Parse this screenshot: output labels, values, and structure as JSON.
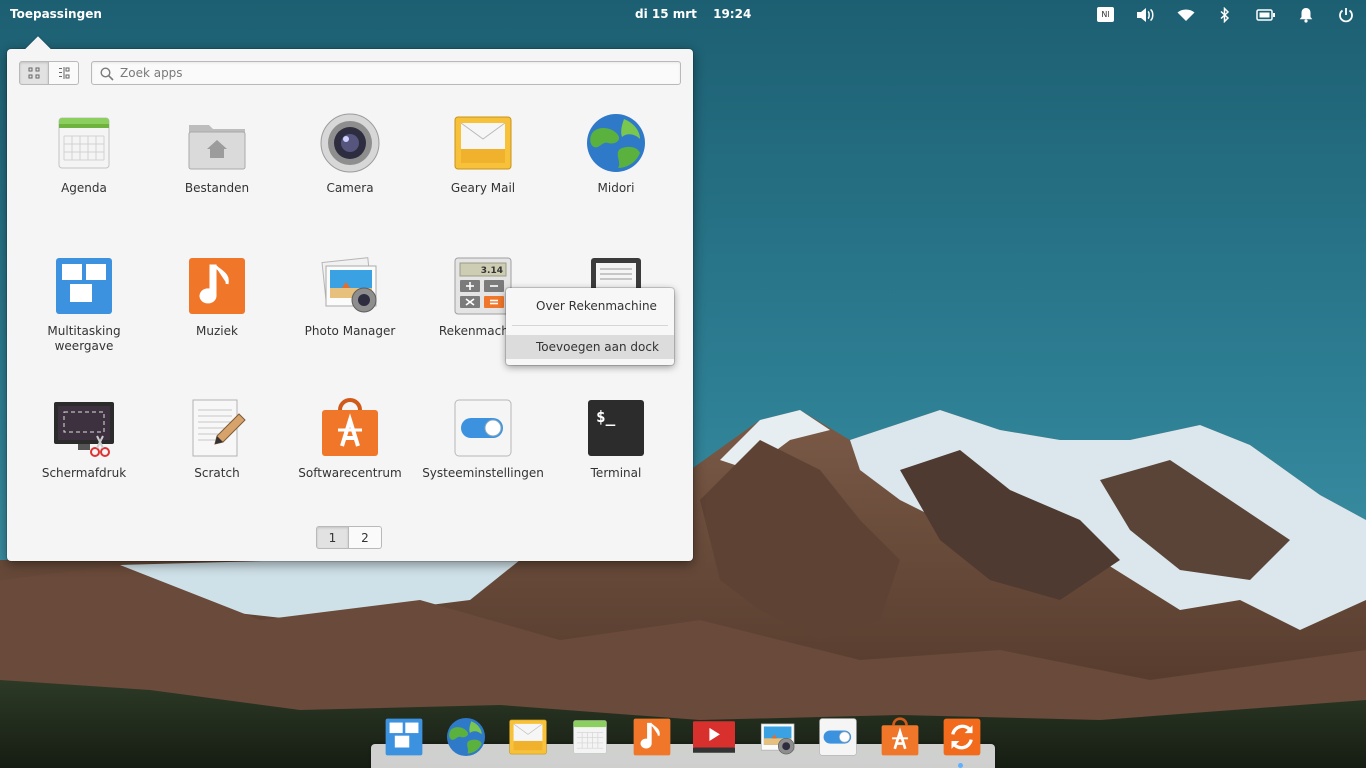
{
  "top_panel": {
    "apps_label": "Toepassingen",
    "date": "di 15 mrt",
    "time": "19:24",
    "keyboard_layout": "Nl"
  },
  "launcher": {
    "search_placeholder": "Zoek apps",
    "apps": [
      {
        "label": "Agenda",
        "icon": "calendar-icon"
      },
      {
        "label": "Bestanden",
        "icon": "folder-home-icon"
      },
      {
        "label": "Camera",
        "icon": "camera-icon"
      },
      {
        "label": "Geary Mail",
        "icon": "mail-icon"
      },
      {
        "label": "Midori",
        "icon": "globe-browser-icon"
      },
      {
        "label": "Multitasking weergave",
        "icon": "multitasking-icon"
      },
      {
        "label": "Muziek",
        "icon": "music-note-icon"
      },
      {
        "label": "Photo Manager",
        "icon": "photo-manager-icon"
      },
      {
        "label": "Rekenmachine",
        "icon": "calculator-icon"
      },
      {
        "label": "",
        "icon": "document-viewer-icon"
      },
      {
        "label": "Schermafdruk",
        "icon": "screenshot-icon"
      },
      {
        "label": "Scratch",
        "icon": "text-editor-icon"
      },
      {
        "label": "Softwarecentrum",
        "icon": "software-center-icon"
      },
      {
        "label": "Systeeminstellingen",
        "icon": "settings-toggle-icon"
      },
      {
        "label": "Terminal",
        "icon": "terminal-icon"
      }
    ],
    "calculator_display": "3.14",
    "terminal_prompt": "$_",
    "pages": [
      "1",
      "2"
    ],
    "current_page": "1"
  },
  "context_menu": {
    "items": [
      {
        "label": "Over Rekenmachine"
      },
      {
        "label": "Toevoegen aan dock",
        "highlighted": true
      }
    ]
  },
  "dock": {
    "items": [
      "multitasking-icon",
      "globe-browser-icon",
      "mail-icon",
      "calendar-icon",
      "music-note-icon",
      "video-icon",
      "photo-manager-icon",
      "settings-toggle-icon",
      "software-center-icon",
      "update-icon"
    ]
  }
}
